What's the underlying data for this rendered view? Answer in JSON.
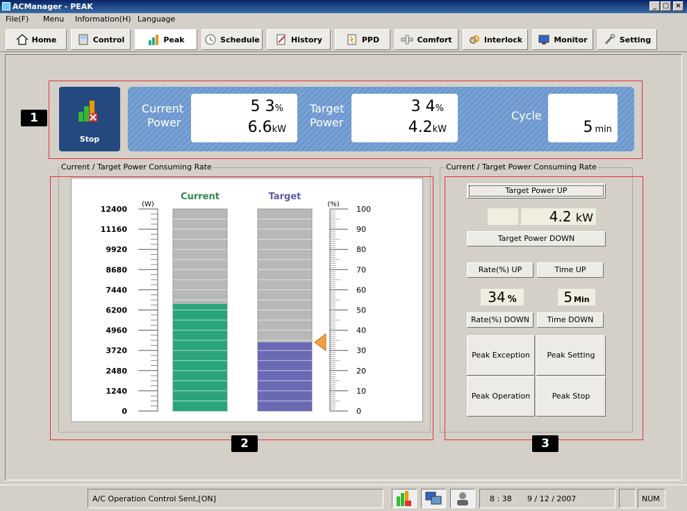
{
  "window": {
    "title": "ACManager - PEAK"
  },
  "menu": [
    "File(F)",
    "Menu",
    "Information(H)",
    "Language"
  ],
  "toolbar": [
    {
      "label": "Home",
      "icon": "home-icon"
    },
    {
      "label": "Control",
      "icon": "control-icon"
    },
    {
      "label": "Peak",
      "icon": "peak-chart-icon"
    },
    {
      "label": "Schedule",
      "icon": "clock-icon"
    },
    {
      "label": "History",
      "icon": "history-icon"
    },
    {
      "label": "PPD",
      "icon": "ppd-icon"
    },
    {
      "label": "Comfort",
      "icon": "comfort-icon"
    },
    {
      "label": "Interlock",
      "icon": "interlock-icon"
    },
    {
      "label": "Monitor",
      "icon": "monitor-icon"
    },
    {
      "label": "Setting",
      "icon": "wrench-icon"
    }
  ],
  "status_panel": {
    "stop_label": "Stop",
    "current_label_1": "Current",
    "current_label_2": "Power",
    "current_pct": "5 3",
    "pct_unit": "%",
    "current_kw": "6.6",
    "kw_unit": "kW",
    "target_label_1": "Target",
    "target_label_2": "Power",
    "target_pct": "3 4",
    "target_kw": "4.2",
    "cycle_label": "Cycle",
    "cycle_value": "5",
    "cycle_unit": "min"
  },
  "chart_group_label": "Current / Target Power Consuming Rate",
  "control_group_label": "Current / Target Power Consuming Rate",
  "badges": [
    "1",
    "2",
    "3"
  ],
  "chart_data": {
    "type": "bar",
    "categories": [
      "Current",
      "Target"
    ],
    "values": [
      53,
      34
    ],
    "left_axis_unit": "(W)",
    "right_axis_unit": "(%)",
    "left_ticks": [
      "12400",
      "11160",
      "9920",
      "8680",
      "7440",
      "6200",
      "4960",
      "3720",
      "2480",
      "1240",
      "0"
    ],
    "right_ticks": [
      "100",
      "90",
      "80",
      "70",
      "60",
      "50",
      "40",
      "30",
      "20",
      "10",
      "0"
    ],
    "ylim": [
      0,
      100
    ],
    "colors": {
      "current": "#2aa57a",
      "target": "#6a6ab4",
      "empty": "#b8b8b8"
    }
  },
  "controls": {
    "target_up": "Target Power UP",
    "target_value": "4.2",
    "target_unit": "kW",
    "target_down": "Target Power DOWN",
    "rate_up": "Rate(%) UP",
    "time_up": "Time UP",
    "rate_value": "34",
    "rate_unit": "%",
    "time_value": "5",
    "time_unit": "Min",
    "rate_down": "Rate(%) DOWN",
    "time_down": "Time DOWN",
    "peak_exception": "Peak Exception",
    "peak_setting": "Peak Setting",
    "peak_operation": "Peak Operation",
    "peak_stop": "Peak Stop"
  },
  "statusbar": {
    "message": "A/C Operation Control Sent,[ON]",
    "time": "8 : 38",
    "date": "9 / 12 / 2007",
    "num": "NUM"
  }
}
